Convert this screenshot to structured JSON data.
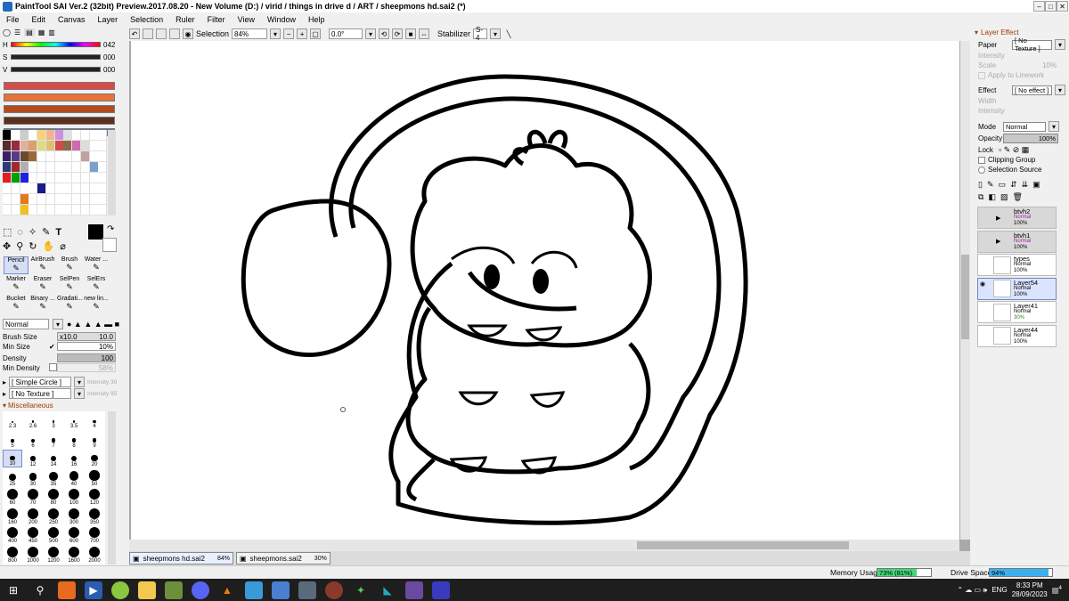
{
  "title": "PaintTool SAI Ver.2 (32bit) Preview.2017.08.20 - New Volume (D:) / virid / things in drive d / ART / sheepmons hd.sai2 (*)",
  "menu": [
    "File",
    "Edit",
    "Canvas",
    "Layer",
    "Selection",
    "Ruler",
    "Filter",
    "View",
    "Window",
    "Help"
  ],
  "toolbar": {
    "selection_label": "Selection",
    "zoom": "84%",
    "angle": "0.0°",
    "stabilizer_label": "Stabilizer",
    "stabilizer_value": "S-4"
  },
  "color": {
    "h_label": "H",
    "h_value": "042",
    "s_label": "S",
    "s_value": "000",
    "v_label": "V",
    "v_value": "000",
    "history": [
      "#d94a4a",
      "#e6733a",
      "#b34a22",
      "#5a3020",
      "#6a7a8a"
    ]
  },
  "swatches": [
    "#000000",
    "#ffffff",
    "#cccccc",
    "#ffffff",
    "#f6d27a",
    "#f2b48e",
    "#cc8ee0",
    "#e0e0e0",
    "#ffffff",
    "#ffffff",
    "#ffffff",
    "#ffffff",
    "#5a2b2b",
    "#9a2b3a",
    "#e0b0a0",
    "#d9a070",
    "#dcdc8a",
    "#e0c070",
    "#d04a4a",
    "#8a6a4a",
    "#d06ab0",
    "#dcdcdc",
    "#ffffff",
    "#ffffff",
    "#3a2060",
    "#5a3a8a",
    "#6a4a2a",
    "#9a6a3a",
    "#ffffff",
    "#ffffff",
    "#ffffff",
    "#ffffff",
    "#ffffff",
    "#c0a0a0",
    "#ffffff",
    "#ffffff",
    "#2a3a7a",
    "#a02a2a",
    "#b0b0b0",
    "#ffffff",
    "#ffffff",
    "#ffffff",
    "#ffffff",
    "#ffffff",
    "#ffffff",
    "#ffffff",
    "#7aa0d0",
    "#ffffff",
    "#e02020",
    "#00a000",
    "#2020e0",
    "#ffffff",
    "#ffffff",
    "#ffffff",
    "#ffffff",
    "#ffffff",
    "#ffffff",
    "#ffffff",
    "#ffffff",
    "#ffffff",
    "#ffffff",
    "#ffffff",
    "#ffffff",
    "#ffffff",
    "#1a1a8a",
    "#ffffff",
    "#ffffff",
    "#ffffff",
    "#ffffff",
    "#ffffff",
    "#ffffff",
    "#ffffff",
    "#ffffff",
    "#ffffff",
    "#e07a20",
    "#ffffff",
    "#ffffff",
    "#ffffff",
    "#ffffff",
    "#ffffff",
    "#ffffff",
    "#ffffff",
    "#ffffff",
    "#ffffff",
    "#ffffff",
    "#ffffff",
    "#f0c020",
    "#ffffff",
    "#ffffff",
    "#ffffff",
    "#ffffff",
    "#ffffff",
    "#ffffff",
    "#ffffff",
    "#ffffff",
    "#ffffff"
  ],
  "tools": [
    {
      "label": "Pencil",
      "icon": "pencil-icon"
    },
    {
      "label": "AirBrush",
      "icon": "airbrush-icon"
    },
    {
      "label": "Brush",
      "icon": "brush-icon"
    },
    {
      "label": "Water ...",
      "icon": "water-icon"
    },
    {
      "label": "Marker",
      "icon": "marker-icon"
    },
    {
      "label": "Eraser",
      "icon": "eraser-icon"
    },
    {
      "label": "SelPen",
      "icon": "selpen-icon"
    },
    {
      "label": "SelErs",
      "icon": "selers-icon"
    },
    {
      "label": "Bucket",
      "icon": "bucket-icon"
    },
    {
      "label": "Binary ...",
      "icon": "binary-icon"
    },
    {
      "label": "Gradati...",
      "icon": "gradation-icon"
    },
    {
      "label": "new lin...",
      "icon": "newline-icon"
    }
  ],
  "brush": {
    "blend_mode": "Normal",
    "size_label": "Brush Size",
    "size_mult": "x10.0",
    "size_value": "10.0",
    "min_size_label": "Min Size",
    "min_size_value": "10%",
    "density_label": "Density",
    "density_value": "100",
    "min_density_label": "Min Density",
    "min_density_value": "58%",
    "shape": "[ Simple Circle ]",
    "shape_intensity": "Intensity 39",
    "texture": "[ No Texture ]",
    "texture_intensity": "Intensity 95",
    "misc_label": "Miscellaneous"
  },
  "brush_sizes": [
    "2.3",
    "2.6",
    "3",
    "3.5",
    "4",
    "5",
    "6",
    "7",
    "8",
    "9",
    "10",
    "12",
    "14",
    "16",
    "20",
    "25",
    "30",
    "35",
    "40",
    "50",
    "60",
    "70",
    "80",
    "100",
    "120",
    "160",
    "200",
    "250",
    "300",
    "350",
    "400",
    "450",
    "500",
    "600",
    "700",
    "800",
    "1000",
    "1200",
    "1600",
    "2000"
  ],
  "docs": [
    {
      "name": "sheepmons hd.sai2",
      "zoom": "84%"
    },
    {
      "name": "sheepmons.sai2",
      "zoom": "30%"
    }
  ],
  "right": {
    "section": "Layer Effect",
    "paper_label": "Paper",
    "paper_value": "[ No Texture ]",
    "intensity_label": "Intensity",
    "scale_label": "Scale",
    "scale_value": "10%",
    "apply_label": "Apply to Linework",
    "effect_label": "Effect",
    "effect_value": "[ No effect ]",
    "width_label": "Width",
    "intensity2_label": "Intensity",
    "mode_label": "Mode",
    "mode_value": "Normal",
    "opacity_label": "Opacity",
    "opacity_value": "100%",
    "lock_label": "Lock",
    "clipping_label": "Clipping Group",
    "selsource_label": "Selection Source"
  },
  "layers": [
    {
      "name": "btvh2",
      "mode": "Normal",
      "opacity": "100%",
      "group": true,
      "sel": false
    },
    {
      "name": "btvh1",
      "mode": "Normal",
      "opacity": "100%",
      "group": true,
      "sel": false
    },
    {
      "name": "types",
      "mode": "Normal",
      "opacity": "100%",
      "group": false,
      "sel": false
    },
    {
      "name": "Layer54",
      "mode": "Normal",
      "opacity": "100%",
      "group": false,
      "sel": true
    },
    {
      "name": "Layer41",
      "mode": "Normal",
      "opacity": "30%",
      "group": false,
      "sel": false
    },
    {
      "name": "Layer44",
      "mode": "Normal",
      "opacity": "100%",
      "group": false,
      "sel": false
    }
  ],
  "status": {
    "memory_label": "Memory Usage",
    "memory_value": "73% (81%)",
    "memory_fraction": 0.73,
    "drive_label": "Drive Space",
    "drive_value": "94%",
    "drive_fraction": 0.94
  },
  "taskbar": {
    "lang": "ENG",
    "time": "8:33 PM",
    "date": "28/09/2023",
    "notif": "4"
  }
}
